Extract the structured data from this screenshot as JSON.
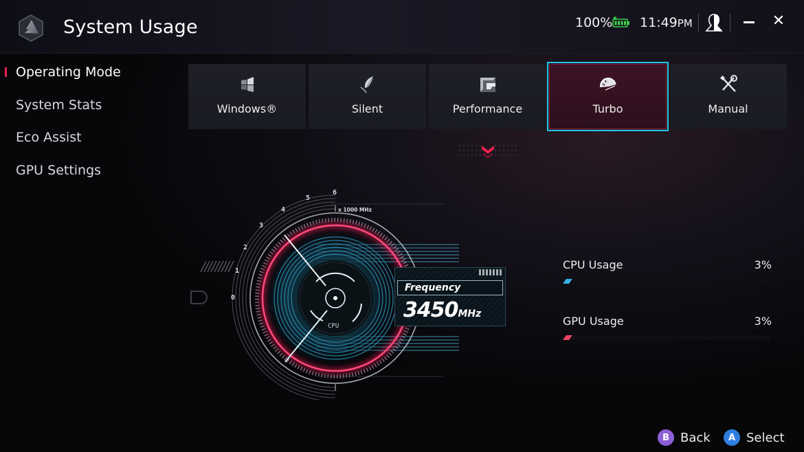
{
  "header": {
    "title": "System Usage",
    "battery_percent": "100%",
    "battery_state": "charging",
    "time": "11:49",
    "time_suffix": "PM"
  },
  "sidebar": {
    "items": [
      {
        "label": "Operating Mode",
        "active": true
      },
      {
        "label": "System Stats",
        "active": false
      },
      {
        "label": "Eco Assist",
        "active": false
      },
      {
        "label": "GPU Settings",
        "active": false
      }
    ]
  },
  "modes": [
    {
      "label": "Windows®",
      "icon": "windows-icon",
      "selected": false
    },
    {
      "label": "Silent",
      "icon": "leaf-icon",
      "selected": false
    },
    {
      "label": "Performance",
      "icon": "performance-icon",
      "selected": false
    },
    {
      "label": "Turbo",
      "icon": "speedometer-icon",
      "selected": true
    },
    {
      "label": "Manual",
      "icon": "tools-icon",
      "selected": false
    }
  ],
  "gauge": {
    "scale_labels": [
      "0",
      "1",
      "2",
      "3",
      "4",
      "5",
      "6"
    ],
    "unit_label": "x 1000 MHz",
    "center_label": "CPU",
    "frequency_title": "Frequency",
    "frequency_value": "3450",
    "frequency_unit": "MHz"
  },
  "usage": {
    "cpu": {
      "label": "CPU Usage",
      "value": "3%",
      "percent": 3,
      "color": "#3ab0e8"
    },
    "gpu": {
      "label": "GPU Usage",
      "value": "3%",
      "percent": 3,
      "color": "#e8455e"
    }
  },
  "footer": {
    "back_label": "Back",
    "back_key": "B",
    "select_label": "Select",
    "select_key": "A"
  },
  "colors": {
    "accent_red": "#e8204e",
    "selection_cyan": "#24c6e8",
    "battery_green": "#3ad14a",
    "back_badge": "#8d5fd6",
    "select_badge": "#2f7fe0"
  }
}
